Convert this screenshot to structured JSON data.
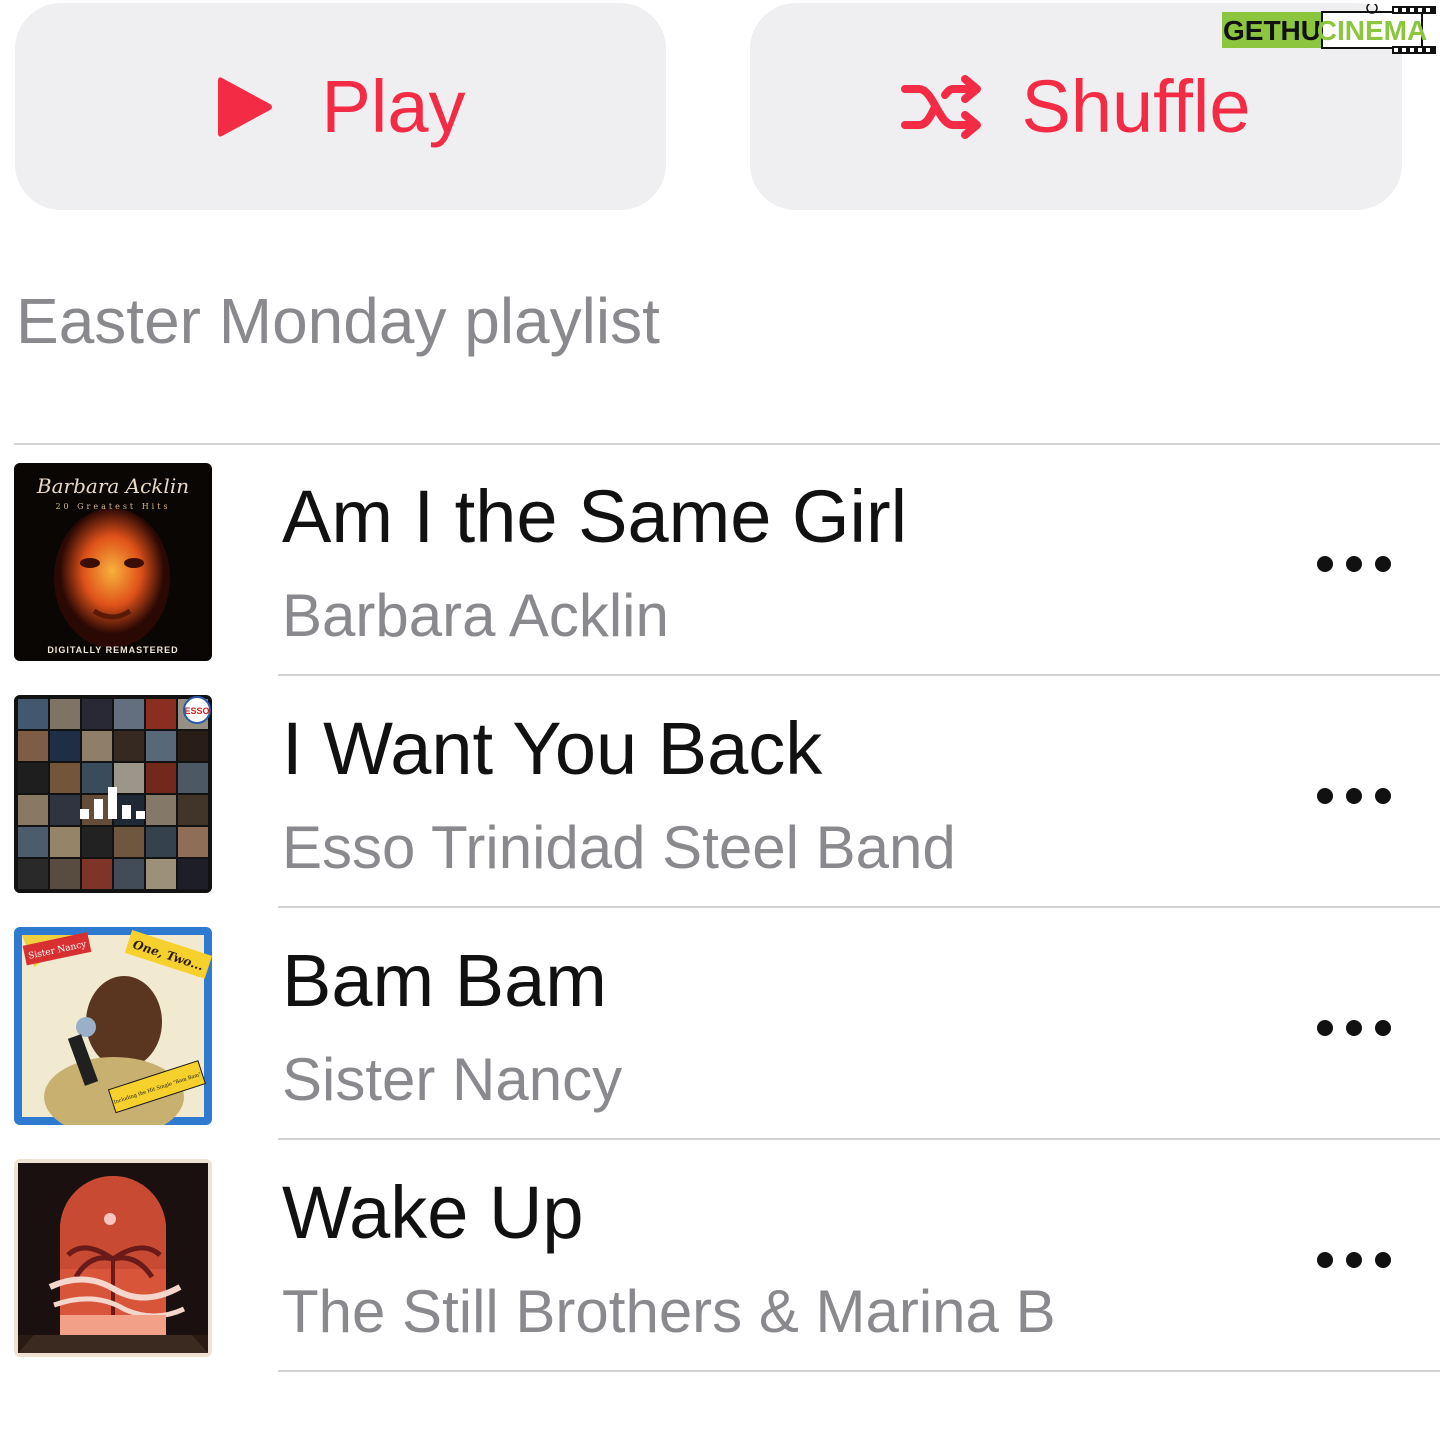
{
  "actions": {
    "play_label": "Play",
    "shuffle_label": "Shuffle",
    "accent_color": "#f42b45"
  },
  "watermark": {
    "text_left": "GETHU",
    "text_right": "CINEMA"
  },
  "playlist": {
    "description": "Easter Monday playlist"
  },
  "tracks": [
    {
      "title": "Am I the Same Girl",
      "artist": "Barbara Acklin",
      "art": {
        "artist_text": "Barbara Acklin",
        "subtitle_text": "20 Greatest Hits",
        "footer_text": "DIGITALLY REMASTERED"
      },
      "more_icon": "ellipsis-icon"
    },
    {
      "title": "I Want You Back",
      "artist": "Esso Trinidad Steel Band",
      "art": {
        "badge_text": "ESSO",
        "playing_icon": "now-playing-bars-icon"
      },
      "more_icon": "ellipsis-icon"
    },
    {
      "title": "Bam Bam",
      "artist": "Sister Nancy",
      "art": {
        "artist_text": "Sister Nancy",
        "title_text": "One, Two...",
        "sticker_text": "Including the Hit Single \"Bam Bam\""
      },
      "more_icon": "ellipsis-icon"
    },
    {
      "title": "Wake Up",
      "artist": "The Still Brothers & Marina B",
      "more_icon": "ellipsis-icon"
    }
  ]
}
